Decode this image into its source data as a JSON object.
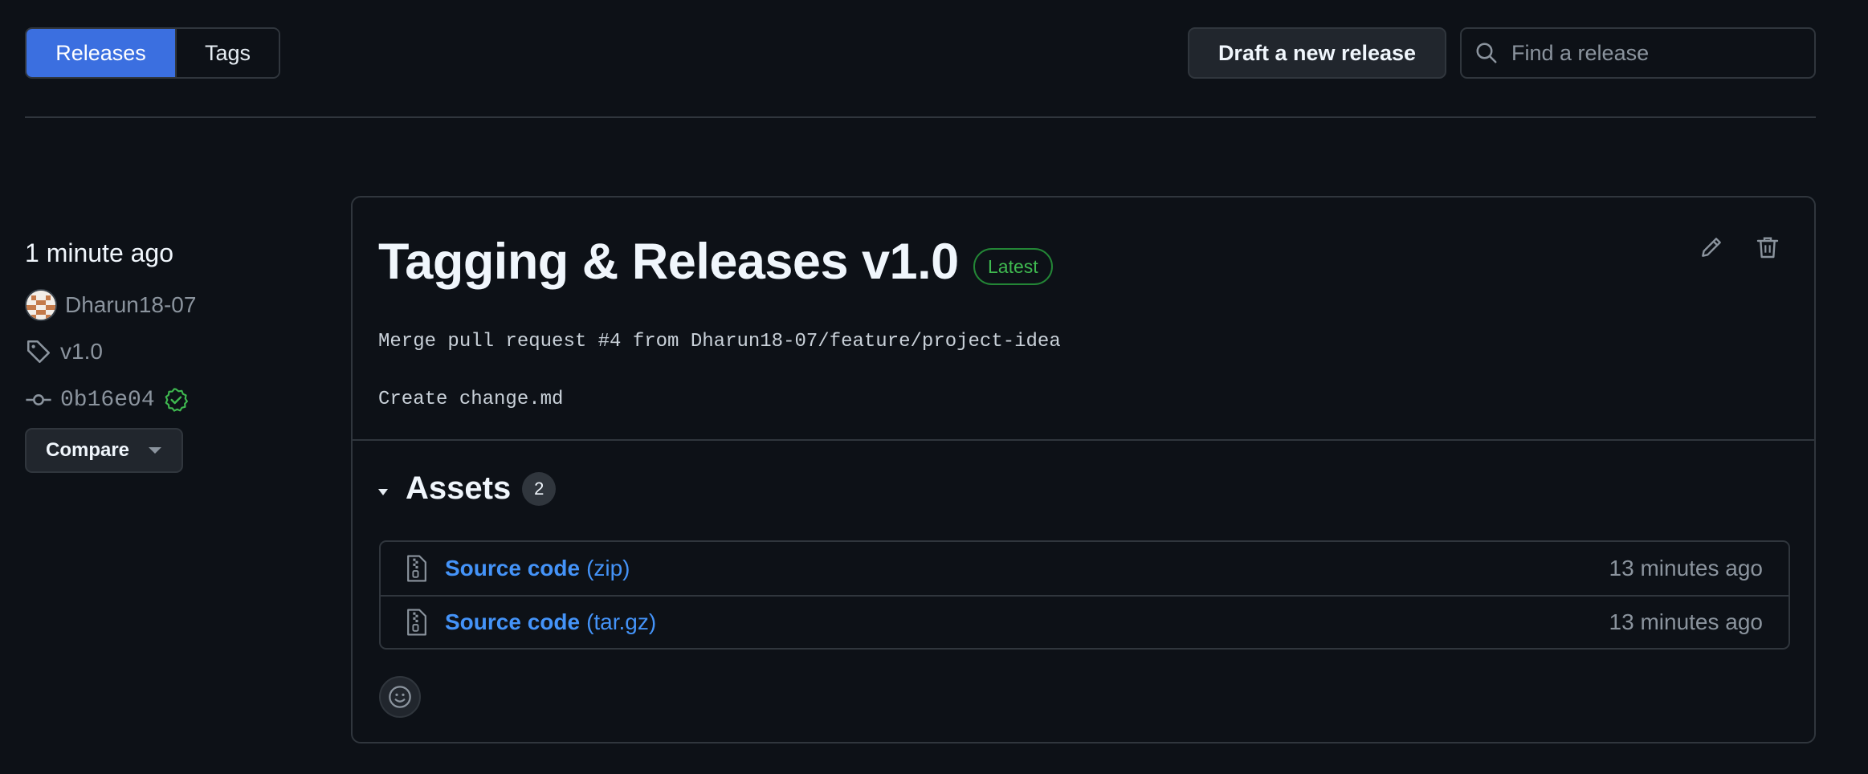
{
  "subnav": {
    "releases_label": "Releases",
    "tags_label": "Tags"
  },
  "toolbar": {
    "draft_label": "Draft a new release"
  },
  "search": {
    "placeholder": "Find a release",
    "value": ""
  },
  "meta": {
    "time": "1 minute ago",
    "author": "Dharun18-07",
    "tag": "v1.0",
    "commit": "0b16e04",
    "compare_label": "Compare"
  },
  "release": {
    "title": "Tagging & Releases v1.0",
    "badge": "Latest",
    "body_line_1": "Merge pull request #4 from Dharun18-07/feature/project-idea",
    "body_line_2": "Create change.md",
    "assets_title": "Assets",
    "assets_count": "2",
    "assets": [
      {
        "name": "Source code",
        "ext": "(zip)",
        "time": "13 minutes ago"
      },
      {
        "name": "Source code",
        "ext": "(tar.gz)",
        "time": "13 minutes ago"
      }
    ]
  },
  "colors": {
    "background": "#0d1117",
    "accent": "#3b6fe0",
    "link": "#4493f8",
    "success": "#3fb950",
    "border": "#30363d"
  },
  "icons": [
    "search-icon",
    "tag-icon",
    "commit-icon",
    "verified-icon",
    "pencil-icon",
    "trash-icon",
    "file-zip-icon",
    "smiley-icon",
    "triangle-down-icon"
  ]
}
